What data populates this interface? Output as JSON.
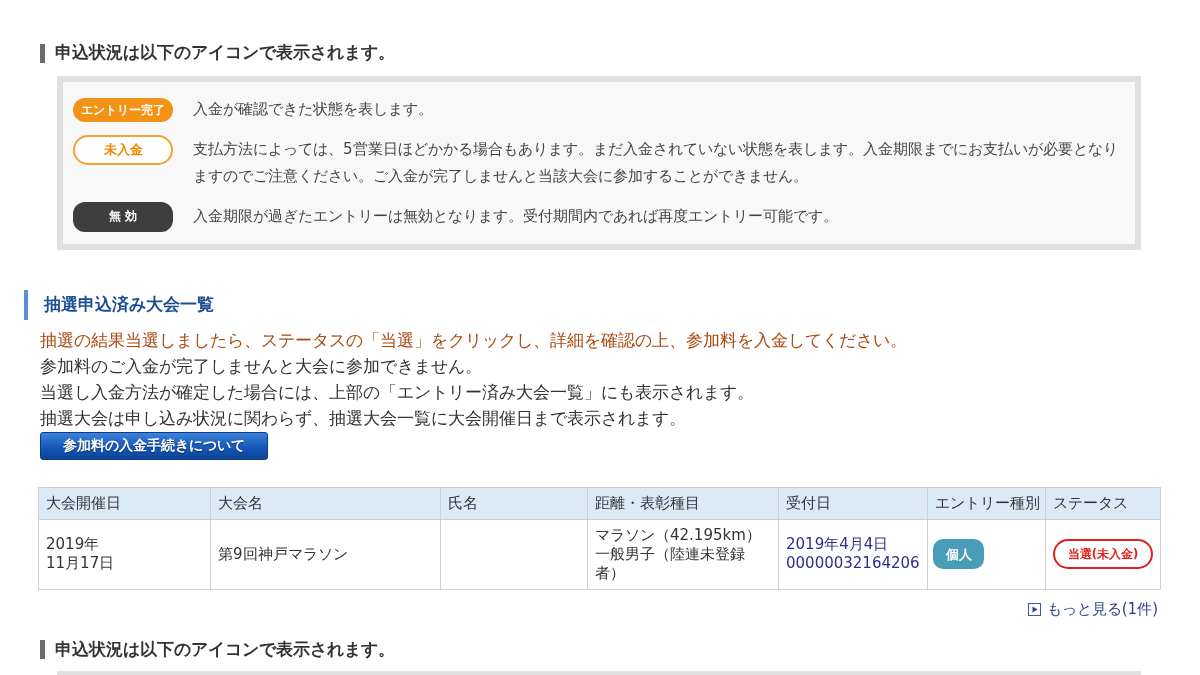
{
  "status_legend": {
    "heading": "申込状況は以下のアイコンで表示されます。",
    "items": [
      {
        "kind": "filled",
        "badge": "エントリー完了",
        "description": "入金が確認できた状態を表します。"
      },
      {
        "kind": "outline",
        "badge": "未入金",
        "description": "支払方法によっては、5営業日ほどかかる場合もあります。まだ入金されていない状態を表します。入金期限までにお支払いが必要となりますのでご注意ください。ご入金が完了しませんと当該大会に参加することができません。"
      },
      {
        "kind": "dark",
        "badge": "無 効",
        "description": "入金期限が過ぎたエントリーは無効となります。受付期間内であれば再度エントリー可能です。"
      }
    ]
  },
  "lottery_section": {
    "heading": "抽選申込済み大会一覧",
    "notice": "抽選の結果当選しましたら、ステータスの「当選」をクリックし、詳細を確認の上、参加料を入金してください。",
    "lines": [
      "参加料のご入金が完了しませんと大会に参加できません。",
      "当選し入金方法が確定した場合には、上部の「エントリー済み大会一覧」にも表示されます。",
      "抽選大会は申し込み状況に関わらず、抽選大会一覧に大会開催日まで表示されます。"
    ],
    "button": "参加料の入金手続きについて",
    "table": {
      "columns": [
        "大会開催日",
        "大会名",
        "氏名",
        "距離・表彰種目",
        "受付日",
        "エントリー種別",
        "ステータス"
      ],
      "rows": [
        {
          "date": [
            "2019年",
            "11月17日"
          ],
          "event": "第9回神戸マラソン",
          "category": [
            "マラソン（42.195km）",
            "一般男子（陸連未登録者）"
          ],
          "received": [
            "2019年4月4日",
            "00000032164206"
          ],
          "entry_type": {
            "kind": "teal",
            "label": "個人"
          },
          "status": {
            "kind": "red-outline",
            "label": "当選(未入金)"
          }
        }
      ]
    },
    "more_link": "もっと見る(1件)"
  },
  "next_heading": "申込状況は以下のアイコンで表示されます。"
}
